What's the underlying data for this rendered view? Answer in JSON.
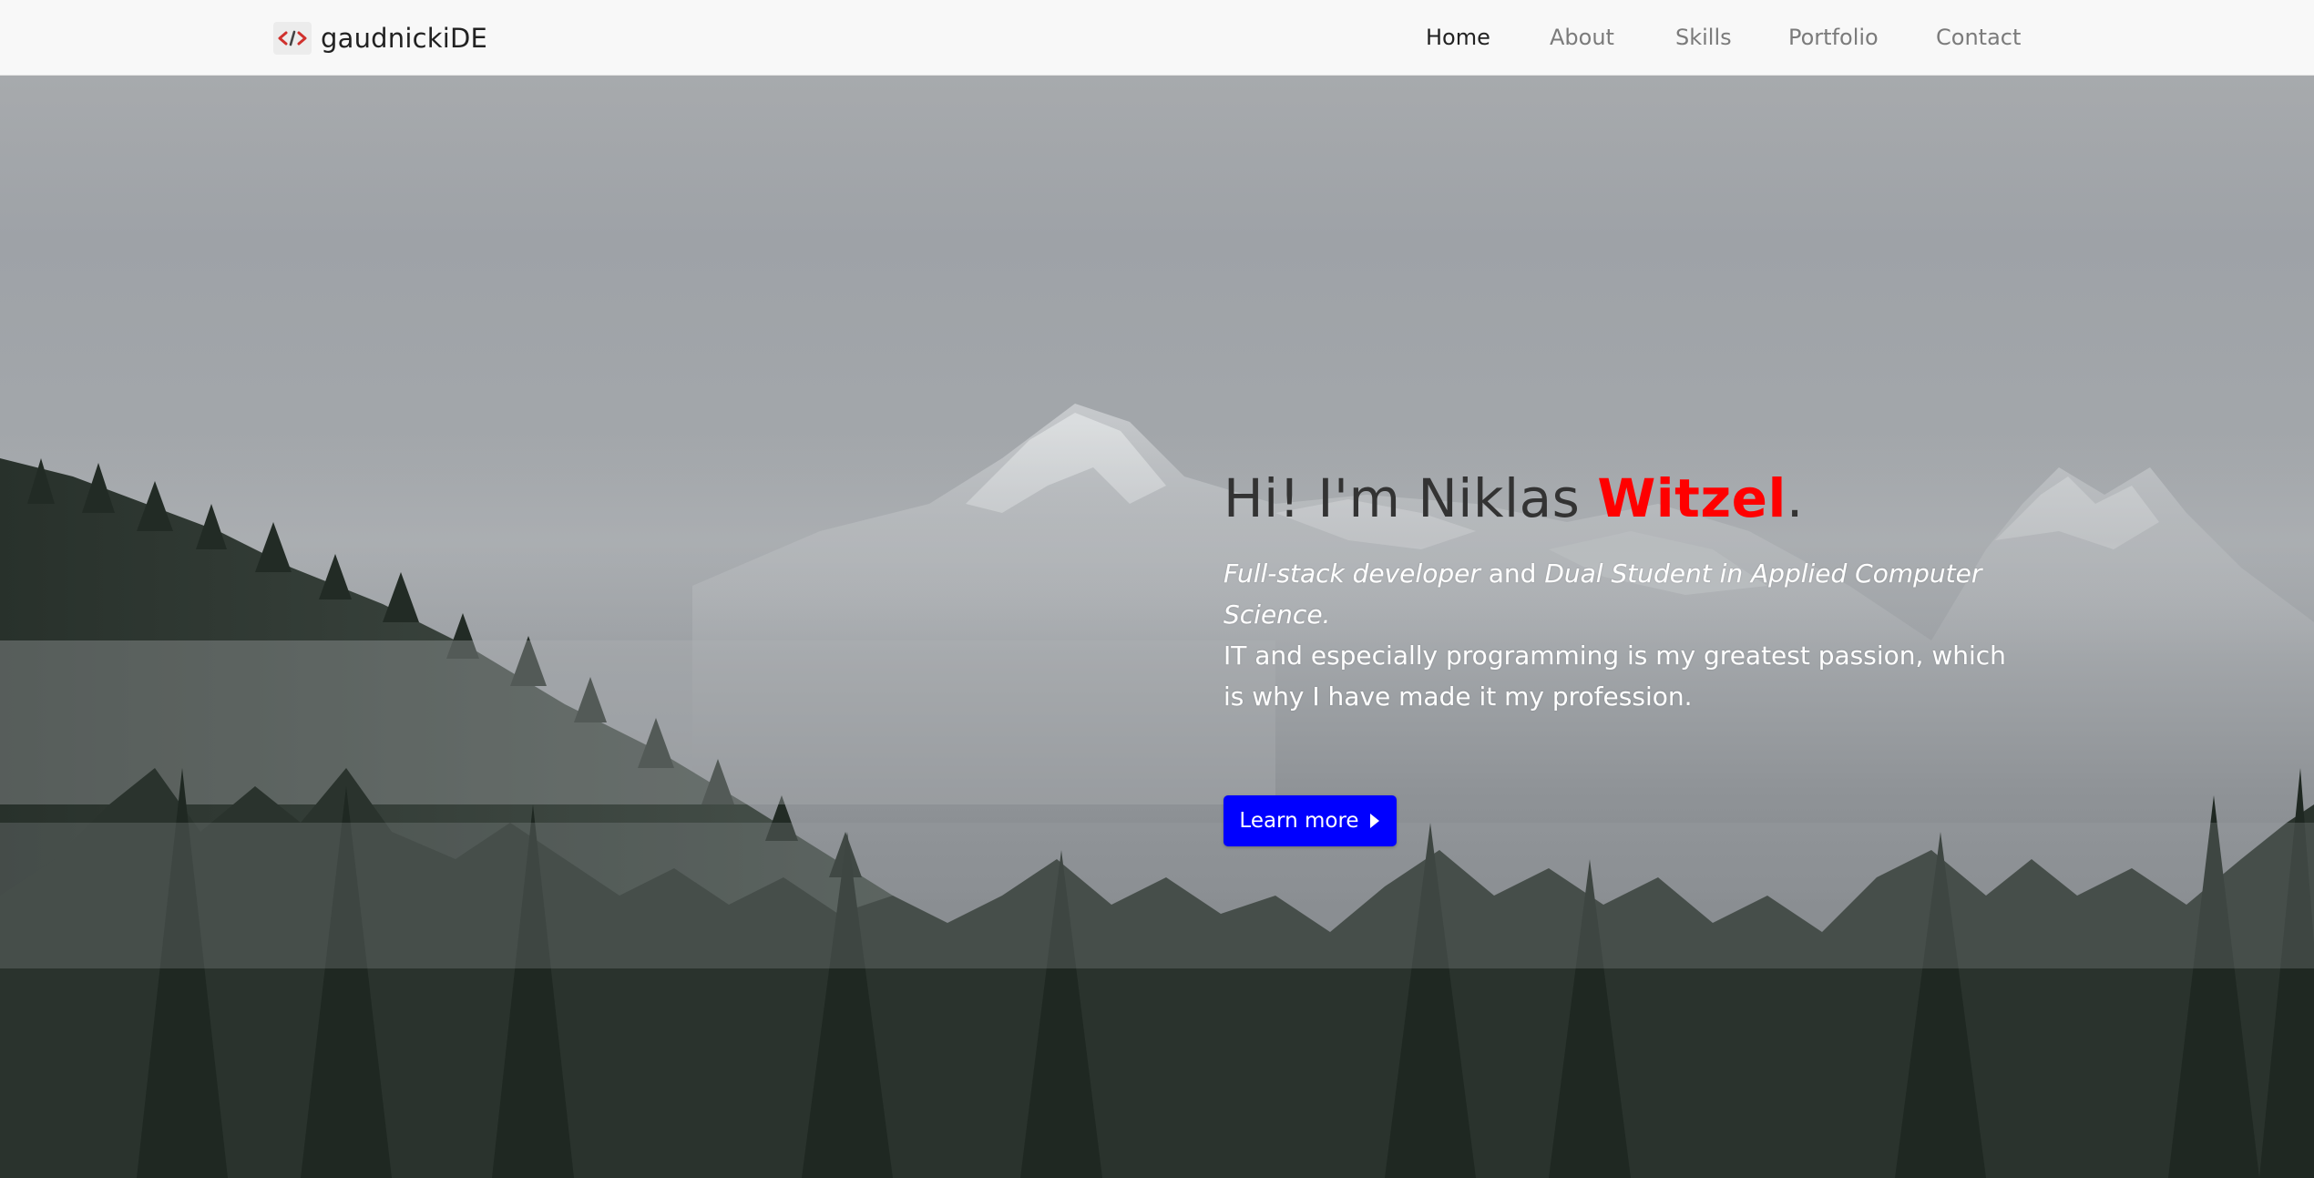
{
  "brand": {
    "name": "gaudnickiDE",
    "logo_icon": "code-brackets-icon"
  },
  "nav": {
    "items": [
      {
        "label": "Home",
        "active": true
      },
      {
        "label": "About",
        "active": false
      },
      {
        "label": "Skills",
        "active": false
      },
      {
        "label": "Portfolio",
        "active": false
      },
      {
        "label": "Contact",
        "active": false
      }
    ]
  },
  "hero": {
    "title_prefix": "Hi! I'm Niklas ",
    "title_accent": "Witzel",
    "title_suffix": ".",
    "role_1": "Full-stack developer",
    "connector": " and ",
    "role_2": "Dual Student in Applied Computer Science.",
    "description": "IT and especially programming is my greatest passion, which is why I have made it my profession.",
    "cta_label": "Learn more",
    "cta_icon": "play-arrow-icon"
  },
  "colors": {
    "accent": "#ff0000",
    "button": "#0000ff",
    "navbar_bg": "#f8f8f8"
  }
}
